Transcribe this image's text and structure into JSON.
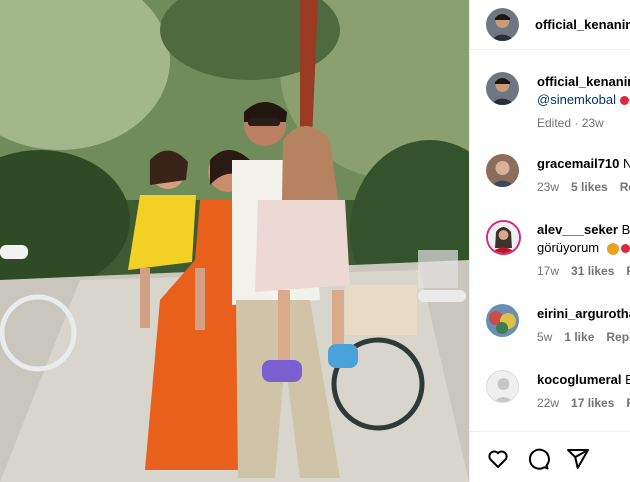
{
  "post": {
    "author": "official_kenanimirzalioglu",
    "author_display": "official_kenanim",
    "caption_author": "official_kenanim",
    "caption_mention": "@sinemkobal",
    "caption_meta": "Edited · 23w"
  },
  "comments": [
    {
      "user": "gracemail710",
      "text": "N",
      "age": "23w",
      "likes": "5 likes",
      "reply": "Rep"
    },
    {
      "user": "alev___seker",
      "text": "Be",
      "text2": "görüyorum",
      "age": "17w",
      "likes": "31 likes",
      "reply": "R"
    },
    {
      "user": "eirini_argurotha",
      "text": "",
      "age": "5w",
      "likes": "1 like",
      "reply": "Reply"
    },
    {
      "user": "kocoglumeral",
      "text": "E",
      "age": "22w",
      "likes": "17 likes",
      "reply": "R"
    }
  ],
  "icons": [
    "heart-icon",
    "comment-icon",
    "share-icon"
  ],
  "colors": {
    "mention": "#00376b",
    "meta": "#737373",
    "border": "#efefef"
  }
}
